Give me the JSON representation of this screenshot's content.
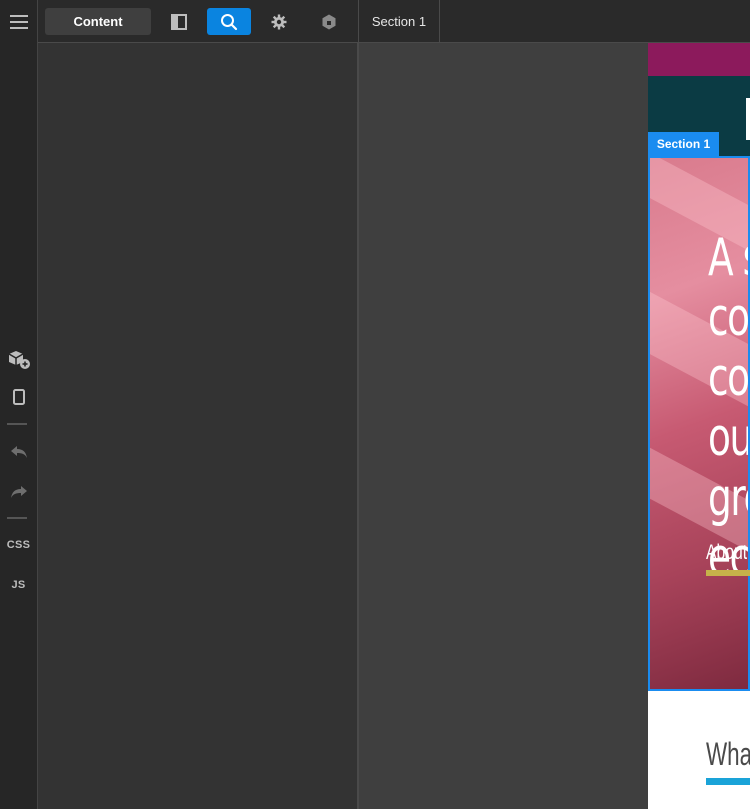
{
  "toolbar": {
    "content_label": "Content",
    "icons": [
      "sidebar-toggle-icon",
      "search-icon",
      "settings-gear-icon",
      "plugin-hex-icon"
    ]
  },
  "tabs": {
    "section_label": "Section 1"
  },
  "rail": {
    "css_label": "CSS",
    "js_label": "JS",
    "icons": [
      "menu-icon",
      "add-block-icon",
      "device-icon",
      "undo-icon",
      "redo-icon"
    ]
  },
  "preview": {
    "section_label": "Section 1",
    "hero_lines": [
      "A s",
      "co",
      "co",
      "ou",
      "gre",
      "ec"
    ],
    "about_text": "About",
    "what_text": "Wha"
  },
  "colors": {
    "accent": "#0a84e0",
    "section_label_bg": "#1a8cf0",
    "preview_strip": "#8c1a5c",
    "preview_header": "#0b3b44"
  }
}
